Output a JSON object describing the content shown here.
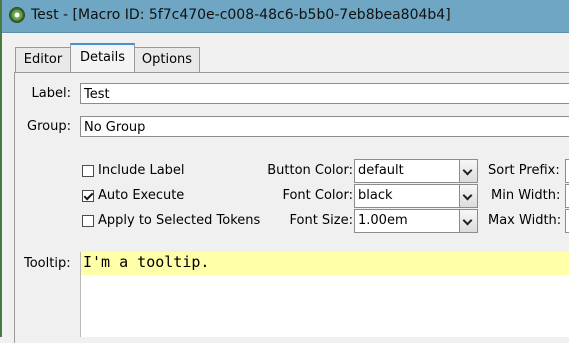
{
  "window": {
    "title": "Test - [Macro ID: 5f7c470e-c008-48c6-b5b0-7eb8bea804b4]"
  },
  "tabs": [
    {
      "label": "Editor",
      "active": false
    },
    {
      "label": "Details",
      "active": true
    },
    {
      "label": "Options",
      "active": false
    }
  ],
  "form": {
    "label_caption": "Label:",
    "label_value": "Test",
    "group_caption": "Group:",
    "group_value": "No Group",
    "include_label": {
      "text": "Include Label",
      "checked": false
    },
    "auto_execute": {
      "text": "Auto Execute",
      "checked": true
    },
    "apply_selected": {
      "text": "Apply to Selected Tokens",
      "checked": false
    },
    "button_color": {
      "caption": "Button Color:",
      "value": "default"
    },
    "font_color": {
      "caption": "Font Color:",
      "value": "black"
    },
    "font_size": {
      "caption": "Font Size:",
      "value": "1.00em"
    },
    "sort_prefix_caption": "Sort Prefix:",
    "min_width_caption": "Min Width:",
    "max_width_caption": "Max Width:",
    "tooltip_caption": "Tooltip:",
    "tooltip_value": "I'm a tooltip."
  },
  "icons": {
    "app": "macro-app-icon",
    "dropdown": "chevron-down-icon"
  }
}
